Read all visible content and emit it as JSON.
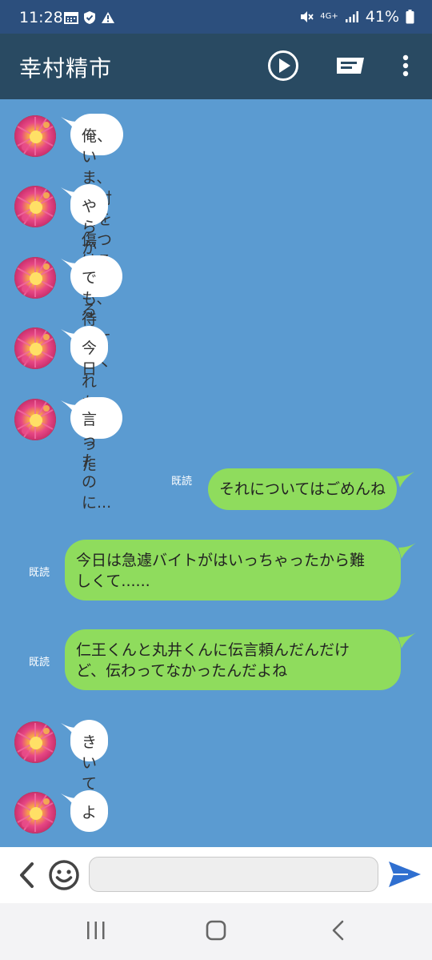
{
  "status": {
    "time": "11:28",
    "battery": "41%",
    "network": "4G+"
  },
  "header": {
    "title": "幸村精市"
  },
  "messages_in": [
    {
      "text": "俺、いま、絶対君を傷つける"
    },
    {
      "text": "やらかしてる"
    },
    {
      "text": "でも、待っててくれなかった"
    },
    {
      "text": "今日"
    },
    {
      "text": "言ったのに..."
    },
    {
      "text": "きいてない"
    },
    {
      "text": "よ"
    }
  ],
  "messages_out": [
    {
      "text": "それについてはごめんね",
      "read": "既読"
    },
    {
      "text": "今日は急遽バイトがはいっちゃったから難\nしくて......",
      "read": "既読"
    },
    {
      "text": "仁王くんと丸井くんに伝言頼んだんだけ\nど、伝わってなかったんだよね",
      "read": "既読"
    }
  ],
  "input": {
    "value": "",
    "placeholder": ""
  },
  "colors": {
    "chat_bg": "#5b9bd1",
    "header": "#294a62",
    "outgoing": "#8fdc5d",
    "incoming": "#ffffff",
    "send": "#2f6fd0"
  }
}
